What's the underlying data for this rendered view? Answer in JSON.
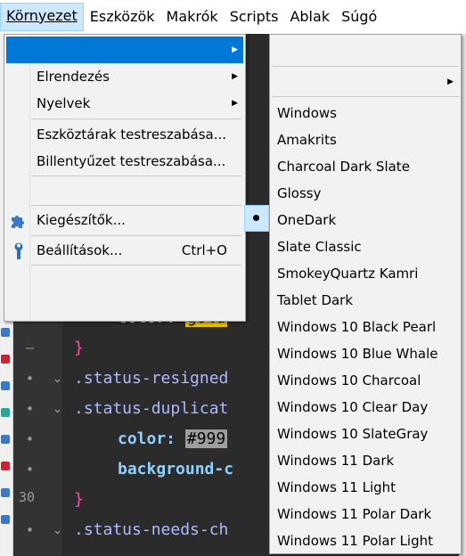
{
  "menubar": {
    "items": [
      {
        "label": "Környezet",
        "active": true
      },
      {
        "label": "Eszközök"
      },
      {
        "label": "Makrók"
      },
      {
        "label": "Scripts"
      },
      {
        "label": "Ablak"
      },
      {
        "label": "Súgó"
      }
    ]
  },
  "menu": {
    "items": [
      {
        "label": "",
        "submenu": true,
        "highlighted": true
      },
      {
        "label": "Elrendezés",
        "submenu": true
      },
      {
        "label": "Nyelvek",
        "submenu": true
      },
      {
        "label": "Eszköztárak testreszabása..."
      },
      {
        "label": "Billentyűzet testreszabása..."
      },
      {
        "label": ""
      },
      {
        "label": "Kiegészítők...",
        "icon": "puzzle-icon"
      },
      {
        "label": "Beállítások...",
        "shortcut": "Ctrl+O",
        "icon": "wrench-icon"
      },
      {
        "label": ""
      }
    ]
  },
  "submenu": {
    "items": [
      {
        "label": ""
      },
      {
        "label": "",
        "submenu": true
      },
      {
        "label": "Windows"
      },
      {
        "label": "Amakrits"
      },
      {
        "label": "Charcoal Dark Slate"
      },
      {
        "label": "Glossy"
      },
      {
        "label": "OneDark",
        "checked": true
      },
      {
        "label": "Slate Classic"
      },
      {
        "label": "SmokeyQuartz Kamri"
      },
      {
        "label": "Tablet Dark"
      },
      {
        "label": "Windows 10 Black Pearl"
      },
      {
        "label": "Windows 10 Blue Whale"
      },
      {
        "label": "Windows 10 Charcoal"
      },
      {
        "label": "Windows 10 Clear Day"
      },
      {
        "label": "Windows 10 SlateGray"
      },
      {
        "label": "Windows 11 Dark"
      },
      {
        "label": "Windows 11 Light"
      },
      {
        "label": "Windows 11 Polar Dark"
      },
      {
        "label": "Windows 11 Polar Light"
      }
    ]
  },
  "editor": {
    "line_number": "30",
    "code": {
      "l1_prop": "color:",
      "l1_val": "gold",
      "l2": "}",
      "l3": ".status-resigned",
      "l4": ".status-duplicat",
      "l5_prop": "color:",
      "l5_val": "#999",
      "l6": "background-c",
      "l7": "}",
      "l8": ".status-needs-ch"
    }
  },
  "colors": {
    "accent": "#0078d7",
    "hover": "#cce8ff",
    "editor_bg": "#2b2b2b"
  }
}
